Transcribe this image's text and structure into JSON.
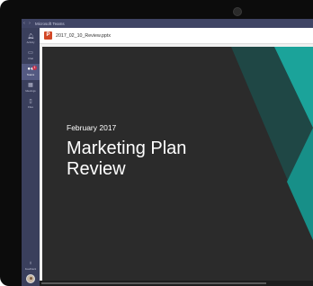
{
  "window": {
    "title": "Microsoft Teams"
  },
  "rail": {
    "items": [
      {
        "label": "Activity",
        "icon": "bell-icon"
      },
      {
        "label": "Chat",
        "icon": "chat-icon"
      },
      {
        "label": "Teams",
        "icon": "teams-icon",
        "badge": "1"
      },
      {
        "label": "Meetings",
        "icon": "calendar-icon"
      },
      {
        "label": "Files",
        "icon": "file-icon"
      }
    ],
    "feedback_label": "Feedback"
  },
  "file": {
    "name": "2017_02_10_Review.pptx",
    "icon_letter": "P"
  },
  "slide": {
    "date": "February 2017",
    "title": "Marketing Plan Review",
    "colors": {
      "background": "#2b2b2b",
      "accent_teal": "#1ba39a",
      "accent_dark": "#1f4745"
    }
  }
}
